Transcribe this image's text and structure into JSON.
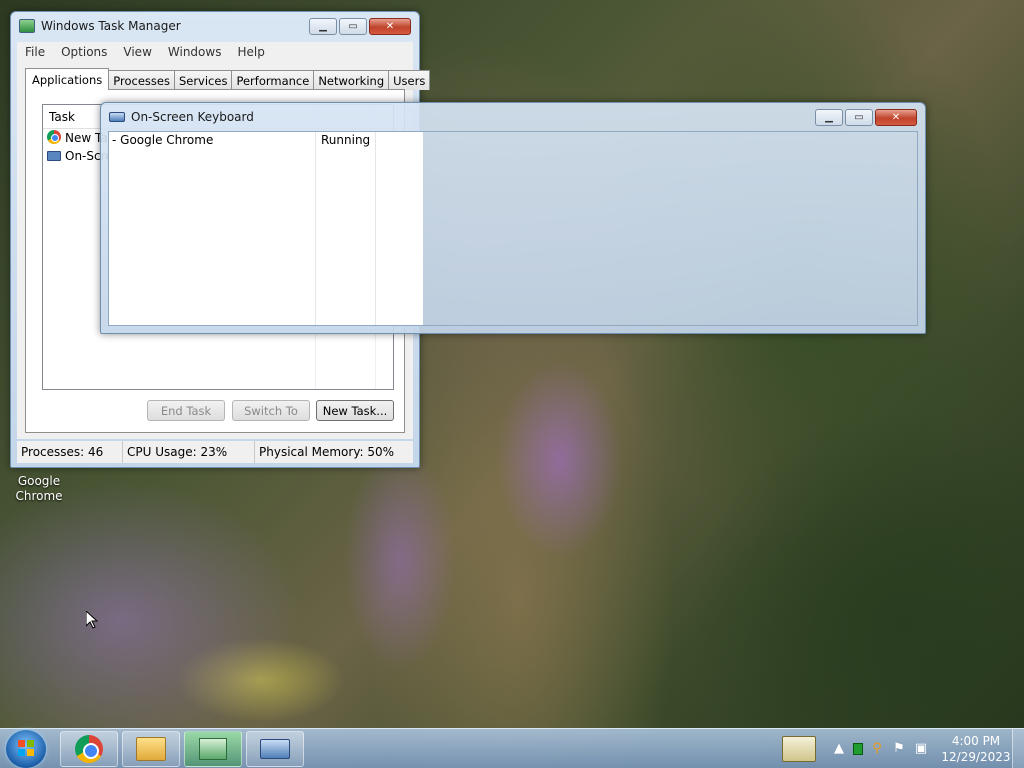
{
  "desktop": {
    "icons": [
      {
        "label": "Google Chrome",
        "icon": "chrome-icon"
      }
    ]
  },
  "task_manager": {
    "title": "Windows Task Manager",
    "menu": [
      "File",
      "Options",
      "View",
      "Windows",
      "Help"
    ],
    "tabs": [
      "Applications",
      "Processes",
      "Services",
      "Performance",
      "Networking",
      "Users"
    ],
    "active_tab": "Applications",
    "list": {
      "header": "Task",
      "rows": [
        {
          "label": "New Ta",
          "icon": "chrome-icon"
        },
        {
          "label": "On-Scre",
          "icon": "keyboard-icon"
        }
      ]
    },
    "buttons": {
      "end_task": "End Task",
      "switch_to": "Switch To",
      "new_task": "New Task..."
    },
    "status": {
      "processes": "Processes: 46",
      "cpu": "CPU Usage: 23%",
      "memory": "Physical Memory: 50%"
    }
  },
  "osk": {
    "title": "On-Screen Keyboard",
    "row": {
      "task": "- Google Chrome",
      "status": "Running"
    }
  },
  "taskbar": {
    "buttons": [
      {
        "name": "chrome-taskbar-button",
        "icon": "chrome-icon"
      },
      {
        "name": "explorer-taskbar-button",
        "icon": "folder-icon"
      },
      {
        "name": "taskmgr-taskbar-button",
        "icon": "task-manager-icon",
        "active": true
      },
      {
        "name": "osk-taskbar-button",
        "icon": "keyboard-icon"
      }
    ],
    "clock": {
      "time": "4:00 PM",
      "date": "12/29/2023"
    }
  }
}
